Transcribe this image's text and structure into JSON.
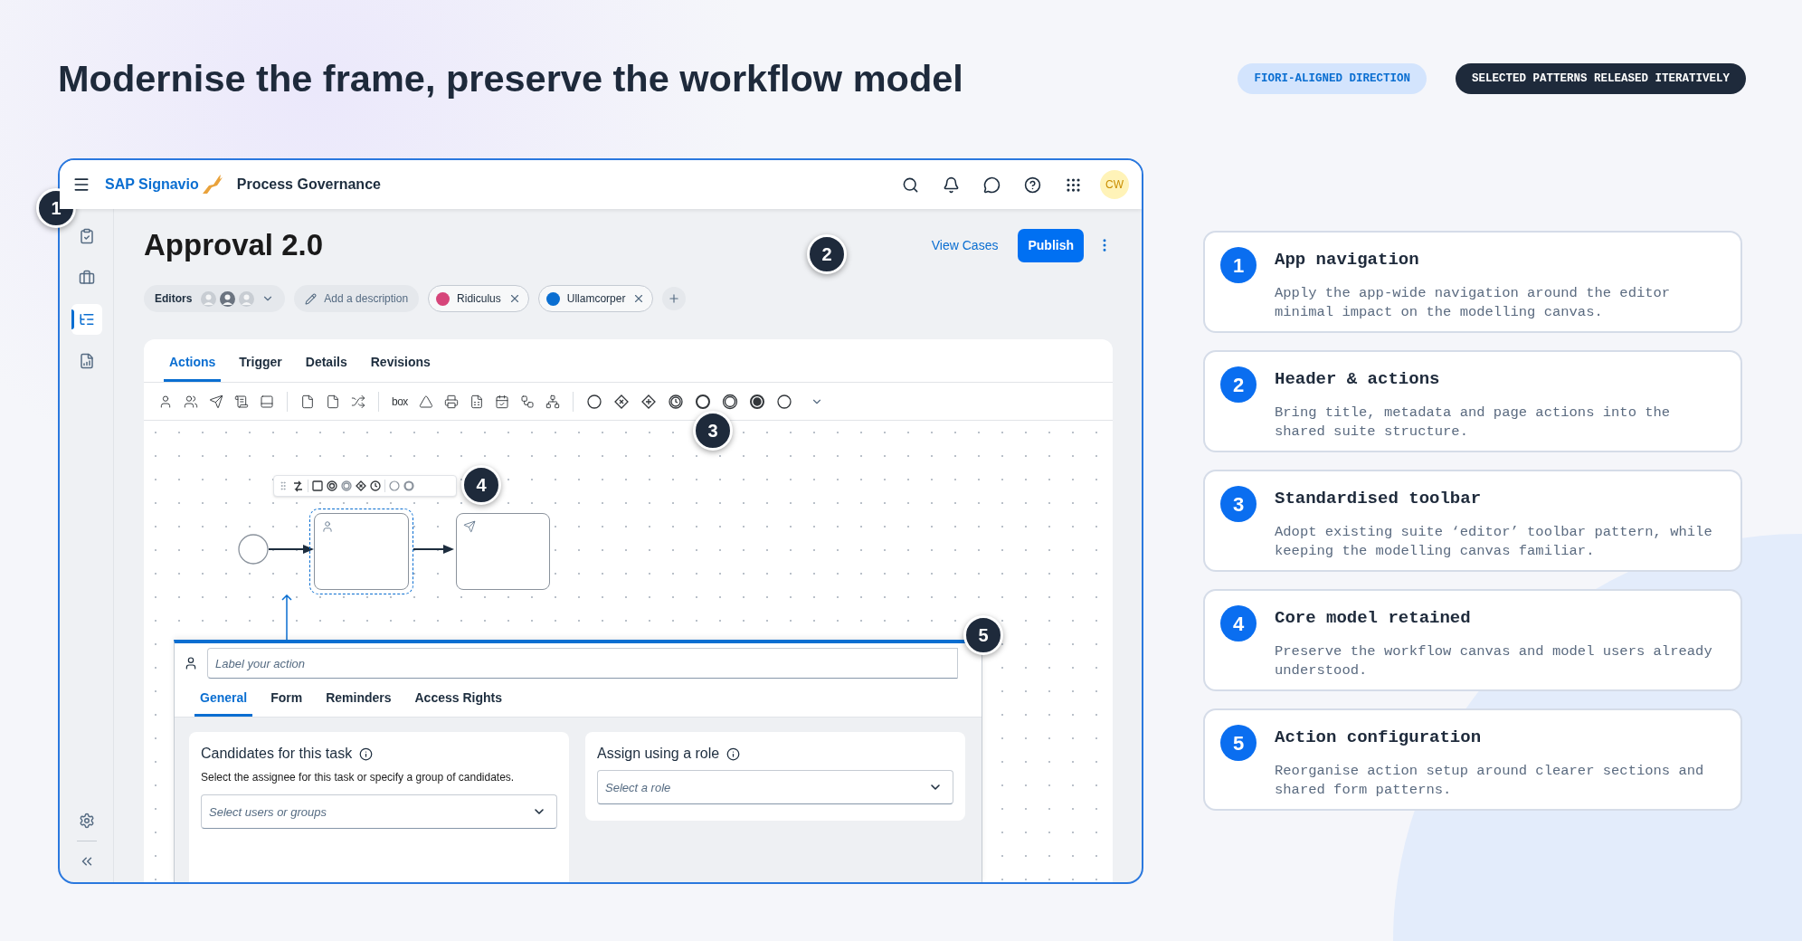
{
  "heading": "Modernise the frame, preserve the workflow model",
  "tags": [
    {
      "label": "FIORI-ALIGNED DIRECTION",
      "kind": "soft"
    },
    {
      "label": "SELECTED PATTERNS RELEASED ITERATIVELY",
      "kind": "dark"
    }
  ],
  "app": {
    "header": {
      "product": "SAP Signavio",
      "title": "Process Governance",
      "avatar": "CW"
    },
    "sidebar": [
      {
        "selected": false
      },
      {
        "selected": false
      },
      {
        "selected": true
      },
      {
        "selected": false
      }
    ],
    "page": {
      "title": "Approval 2.0",
      "link": "View Cases",
      "primary": "Publish",
      "editors": "Editors",
      "description_button": "Add a description",
      "labels": [
        {
          "name": "Ridiculus",
          "color": "#d6457a"
        },
        {
          "name": "Ullamcorper",
          "color": "#0a6ed1"
        }
      ]
    },
    "tabs": [
      {
        "label": "Actions",
        "selected": true
      },
      {
        "label": "Trigger",
        "selected": false
      },
      {
        "label": "Details",
        "selected": false
      },
      {
        "label": "Revisions",
        "selected": false
      }
    ],
    "toolbar": {
      "brand": "box"
    },
    "panel": {
      "placeholder": "Label your action",
      "tabs": [
        {
          "label": "General",
          "selected": true
        },
        {
          "label": "Form",
          "selected": false
        },
        {
          "label": "Reminders",
          "selected": false
        },
        {
          "label": "Access Rights",
          "selected": false
        }
      ],
      "candidates": {
        "title": "Candidates for this task",
        "text": "Select the assignee for this task or specify a group of candidates.",
        "placeholder": "Select users or groups"
      },
      "role": {
        "title": "Assign using a role",
        "placeholder": "Select a role"
      }
    }
  },
  "callouts": [
    "1",
    "2",
    "3",
    "4",
    "5"
  ],
  "notes": [
    {
      "number": "1",
      "title": "App navigation",
      "text": "Apply the app-wide navigation around the editor minimal impact on the modelling canvas."
    },
    {
      "number": "2",
      "title": "Header & actions",
      "text": "Bring title, metadata and page actions into the shared suite structure."
    },
    {
      "number": "3",
      "title": "Standardised toolbar",
      "text": "Adopt existing suite ‘editor’ toolbar pattern, while keeping the modelling canvas familiar."
    },
    {
      "number": "4",
      "title": "Core model retained",
      "text": "Preserve the workflow canvas and model users already understood."
    },
    {
      "number": "5",
      "title": "Action configuration",
      "text": "Reorganise action setup around clearer sections and shared form patterns."
    }
  ]
}
